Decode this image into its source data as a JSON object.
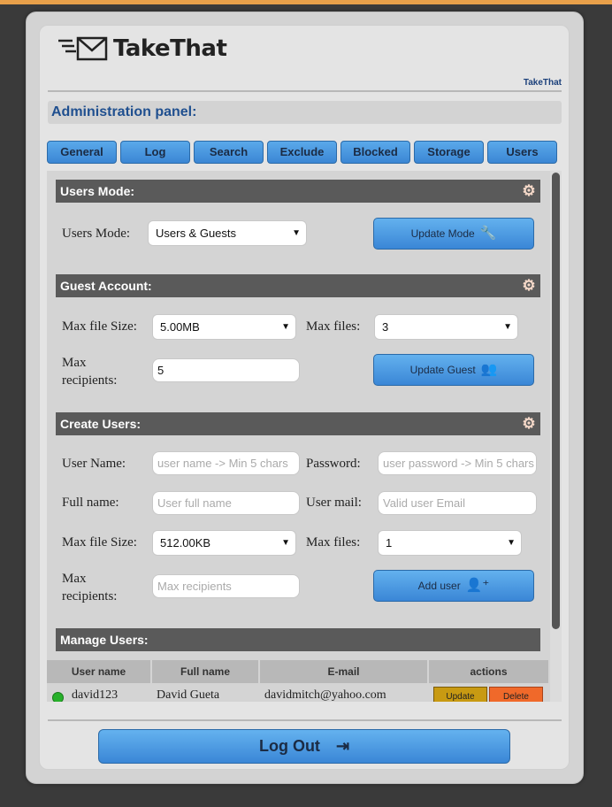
{
  "app": {
    "logo_text": "TakeThat",
    "brand_small": "TakeThat"
  },
  "page_title": "Administration panel:",
  "tabs": [
    "General",
    "Log",
    "Search",
    "Exclude",
    "Blocked",
    "Storage",
    "Users"
  ],
  "users_mode": {
    "title": "Users Mode:",
    "label": "Users Mode:",
    "selected": "Users & Guests",
    "button": "Update Mode"
  },
  "guest_account": {
    "title": "Guest Account:",
    "max_file_size_label": "Max file Size:",
    "max_file_size_value": "5.00MB",
    "max_files_label": "Max files:",
    "max_files_value": "3",
    "max_recipients_label_1": "Max",
    "max_recipients_label_2": "recipients:",
    "max_recipients_value": "5",
    "button": "Update Guest"
  },
  "create_users": {
    "title": "Create Users:",
    "user_name_label": "User Name:",
    "user_name_placeholder": "user name -> Min 5 chars",
    "password_label": "Password:",
    "password_placeholder": "user password -> Min 5 chars",
    "full_name_label": "Full name:",
    "full_name_placeholder": "User full name",
    "user_mail_label": "User mail:",
    "user_mail_placeholder": "Valid user Email",
    "max_file_size_label": "Max file Size:",
    "max_file_size_value": "512.00KB",
    "max_files_label": "Max files:",
    "max_files_value": "1",
    "max_recipients_label_1": "Max",
    "max_recipients_label_2": "recipients:",
    "max_recipients_placeholder": "Max recipients",
    "button": "Add user"
  },
  "manage_users": {
    "title": "Manage Users:",
    "columns": [
      "User name",
      "Full name",
      "E-mail",
      "actions"
    ],
    "rows": [
      {
        "user_name": "david123",
        "full_name": "David Gueta",
        "email": "davidmitch@yahoo.com",
        "update": "Update",
        "delete": "Delete"
      }
    ]
  },
  "logout": "Log Out",
  "colors": {
    "accent_blue": "#3a86d6",
    "section_header": "#5a5a5a",
    "status_online": "#27b02a",
    "update_btn": "#c89a12",
    "delete_btn": "#f0692a"
  }
}
